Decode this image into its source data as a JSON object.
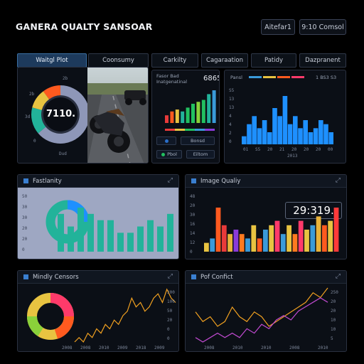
{
  "header": {
    "title": "GANERA QUALTY SANSOAR",
    "btn_left": "Aitefar1",
    "btn_right": "9:10 Comsol"
  },
  "tabs": [
    "Waitgl Plot",
    "Coonsumy",
    "Carkilty",
    "Cagaraation",
    "Patidy",
    "Dazpranent"
  ],
  "gauge": {
    "value": "7110.",
    "labels": [
      "2b",
      "2b",
      "3d",
      "0"
    ],
    "caption": "Dud"
  },
  "mini": {
    "header_left": "Fasor Bad",
    "header_left_sub": "Inatgenatinal",
    "value": "6865",
    "bars": [
      4,
      6,
      7,
      6,
      8,
      10,
      11,
      12,
      15,
      17
    ],
    "btn1": "Pbol",
    "btn2": "Bonsd",
    "btn3": "Eiltom"
  },
  "hist": {
    "legend_left": "Pansl",
    "legend_right": "1 BS3 S3",
    "bars": [
      2,
      5,
      7,
      4,
      6,
      3,
      9,
      7,
      12,
      5,
      7,
      4,
      6,
      3,
      4,
      6,
      5,
      3
    ],
    "xlabels": [
      "01",
      "S5",
      "20",
      "21",
      "20",
      "20",
      "20",
      "00"
    ],
    "ylabels": [
      "S5",
      "13",
      "13",
      "4",
      "4",
      "2",
      "0"
    ],
    "caption": "2013"
  },
  "fastlity": {
    "title": "Fastlanity",
    "bars": [
      6,
      4,
      7,
      6,
      5,
      5,
      3,
      3,
      4,
      5,
      4,
      6
    ],
    "ylabels": [
      "50",
      "30",
      "30",
      "20",
      "20",
      "0"
    ]
  },
  "image_quality": {
    "title": "Image Qualiy",
    "value": "29:319.",
    "bars": [
      2,
      3,
      10,
      6,
      4,
      5,
      4,
      3,
      6,
      3,
      5,
      6,
      7,
      4,
      6,
      4,
      7,
      5,
      6,
      8,
      6,
      7,
      10
    ],
    "bar_colors": [
      "#e8c341",
      "#3a9ad9",
      "#ff5a1f",
      "#e83a3a",
      "#e8b23a",
      "#8a3ad9",
      "#ff7a1f",
      "#3a9ad9",
      "#e8c341",
      "#ff5a1f",
      "#3a9ad9",
      "#e8c341",
      "#ff3a6a",
      "#3a9ad9",
      "#e8c341",
      "#ff7a1f",
      "#ff3a6a",
      "#e8c341",
      "#3a9ad9",
      "#e8b23a",
      "#ff5a1f",
      "#e8c341",
      "#ff3a3a"
    ],
    "ylabels": [
      "48",
      "20",
      "30",
      "16",
      "14",
      "12",
      "0"
    ]
  },
  "mindy": {
    "title": "Mindly Censors",
    "ylabels": [
      "200",
      "100",
      "50",
      "20",
      "0",
      "0"
    ],
    "xlabels": [
      "2008",
      "2008",
      "2010",
      "2009",
      "2018",
      "2009"
    ],
    "line": [
      2,
      3,
      2,
      4,
      3,
      5,
      4,
      6,
      5,
      7,
      6,
      8,
      9,
      12,
      10,
      11,
      9,
      10,
      12,
      13,
      11,
      14,
      12,
      11
    ]
  },
  "pof": {
    "title": "Pof Confict",
    "ylabels": [
      "250",
      "20",
      "20",
      "10",
      "10",
      "5"
    ],
    "xlabels": [
      "2008",
      "2010",
      "2010",
      "2008",
      "2010"
    ],
    "line1": [
      8,
      6,
      7,
      5,
      6,
      9,
      7,
      6,
      8,
      7,
      5,
      6,
      7,
      8,
      9,
      10,
      12,
      11,
      13
    ],
    "line2": [
      2,
      1,
      2,
      3,
      2,
      3,
      2,
      4,
      3,
      5,
      4,
      6,
      7,
      6,
      8,
      9,
      10,
      11,
      10
    ]
  },
  "colors": {
    "accent_blue": "#1e90ff",
    "green": "#22b39a",
    "gauge_bg": "#9aa3c0"
  }
}
